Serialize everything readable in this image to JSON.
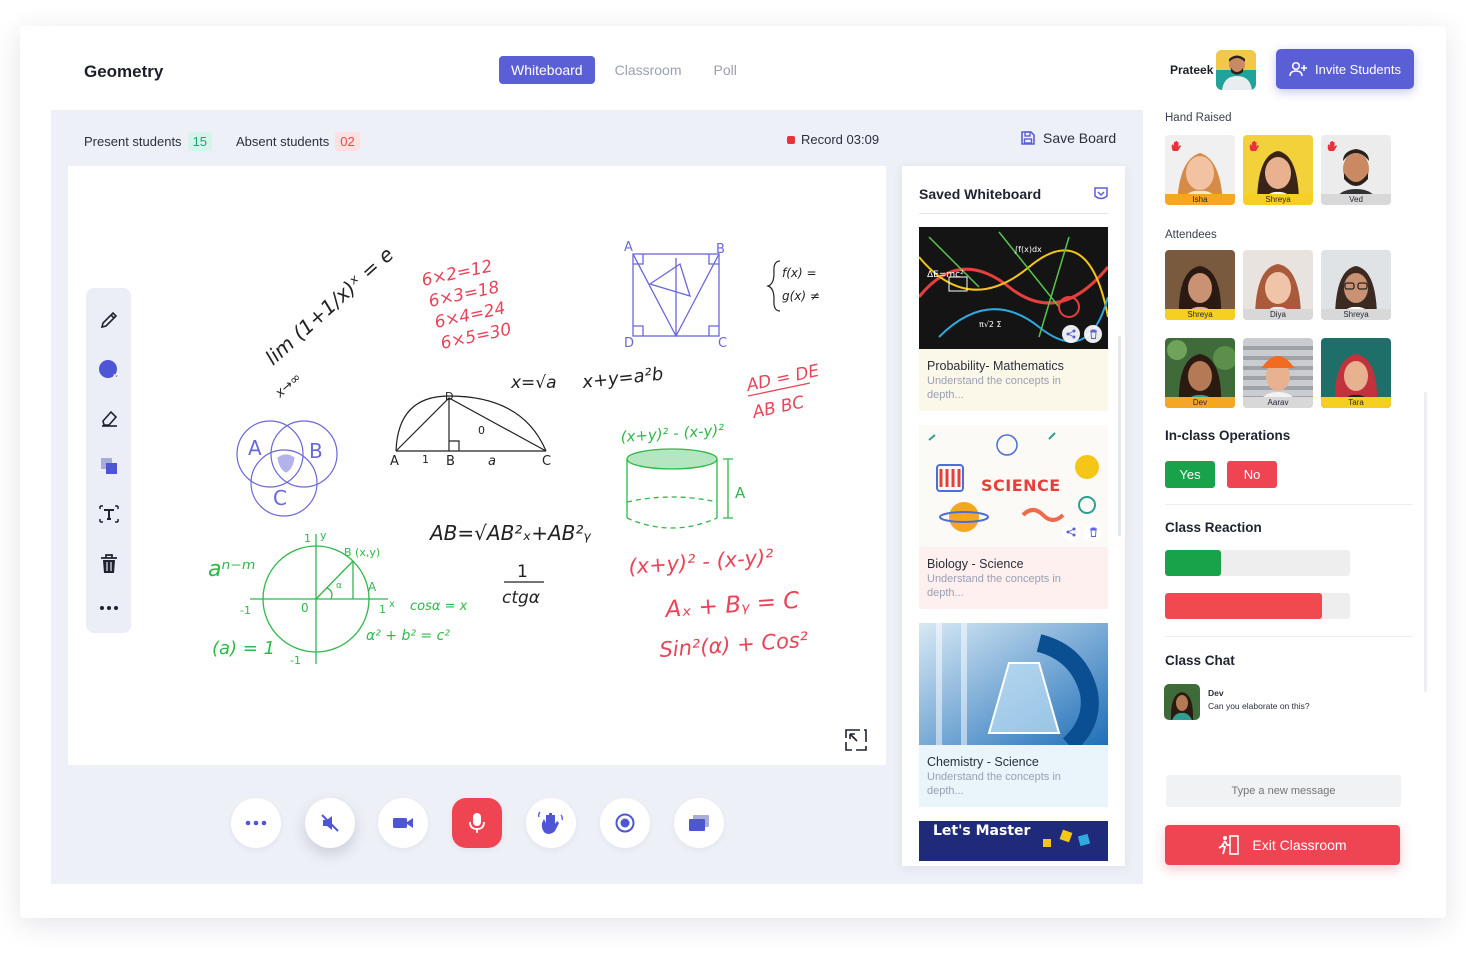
{
  "header": {
    "course_title": "Geometry",
    "tabs": [
      {
        "label": "Whiteboard",
        "active": true
      },
      {
        "label": "Classroom",
        "active": false
      },
      {
        "label": "Poll",
        "active": false
      }
    ],
    "user_name": "Prateek",
    "invite_label": "Invite Students",
    "accent_color": "#5b5fd6"
  },
  "stage": {
    "present_label": "Present students",
    "present_count": "15",
    "absent_label": "Absent students",
    "absent_count": "02",
    "record_label": "Record 03:09",
    "save_label": "Save Board"
  },
  "toolbar": {
    "tools": [
      "pencil-icon",
      "color-picker-icon",
      "eraser-icon",
      "layers-icon",
      "text-tool-icon",
      "trash-icon",
      "more-icon"
    ]
  },
  "whiteboard": {
    "notes": {
      "limit": "lim (1+1/x)ˣ = e",
      "limit_sub": "x→∞",
      "times": [
        "6×2=12",
        "6×3=18",
        "6×4=24",
        "6×5=30"
      ],
      "square_labels": [
        "A",
        "B",
        "D",
        "C"
      ],
      "fx": "f(x) =",
      "gx": "g(x) ≠",
      "sqrt": "x=√a",
      "xy": "x+y=a²b",
      "ratio_top": "AD = DE",
      "ratio_bottom": "AB   BC",
      "arc_labels": [
        "D",
        "A",
        "1",
        "B",
        "a",
        "C",
        "0"
      ],
      "venn": [
        "A",
        "B",
        "C"
      ],
      "poly": "(x+y)² - (x-y)²",
      "cyl_label": "A",
      "ab": "AB=√AB²ₓ+AB²ᵧ",
      "ctg_num": "1",
      "ctg_den": "ctgα",
      "poly2": "(x+y)² - (x-y)²",
      "sum": "Aₓ + Bᵧ = C",
      "trig": "Sin²(α) + Cos²",
      "anm": "aⁿ⁻ᵐ",
      "a1": "(a) = 1",
      "circle_labels": [
        "1",
        "y",
        "B (x,y)",
        "A",
        "-1",
        "0",
        "1",
        "x",
        "-1",
        "α"
      ],
      "cos": "cosα = x",
      "pyth": "α² + b² = c²"
    },
    "colors": {
      "ink": "#222222",
      "red": "#e8445a",
      "blue": "#6a67d8",
      "green": "#2fb84a"
    }
  },
  "controls": [
    "more-icon",
    "speaker-mute-icon",
    "video-icon",
    "mic-icon",
    "hand-wave-icon",
    "record-icon",
    "screen-share-icon"
  ],
  "saved": {
    "title": "Saved Whiteboard",
    "cards": [
      {
        "title": "Probability- Mathematics",
        "desc": "Understand the concepts in depth...",
        "bg": "#fbf8ea"
      },
      {
        "title": "Biology - Science",
        "desc": "Understand the concepts in depth...",
        "bg": "#fdf0ee",
        "img_text": "SCIENCE"
      },
      {
        "title": "Chemistry - Science",
        "desc": "Understand the concepts in depth...",
        "bg": "#e9f4fb"
      },
      {
        "title": "Let's Master",
        "desc": "",
        "bg": "#ffffff"
      }
    ]
  },
  "sidebar": {
    "hand_raised_label": "Hand Raised",
    "hand_raised": [
      {
        "name": "Isha",
        "color": "#f5a623"
      },
      {
        "name": "Shreya",
        "color": "#f5d020"
      },
      {
        "name": "Ved",
        "color": "#d8d8d8"
      }
    ],
    "attendees_label": "Attendees",
    "attendees": [
      {
        "name": "Shreya",
        "color": "#f5d020"
      },
      {
        "name": "Diya",
        "color": "#d8d8d8"
      },
      {
        "name": "Shreya",
        "color": "#d8d8d8"
      },
      {
        "name": "Dev",
        "color": "#f5a623"
      },
      {
        "name": "Aarav",
        "color": "#d8d8d8"
      },
      {
        "name": "Tara",
        "color": "#f5d020"
      }
    ],
    "operations_label": "In-class Operations",
    "yes_label": "Yes",
    "no_label": "No",
    "reaction_label": "Class Reaction",
    "reactions": [
      {
        "level": 0.3,
        "color": "#18a24a"
      },
      {
        "level": 0.85,
        "color": "#f04a50"
      }
    ],
    "chat_label": "Class Chat",
    "chat": [
      {
        "name": "Dev",
        "text": "Can you elaborate on this?"
      }
    ],
    "message_placeholder": "Type a new message",
    "exit_label": "Exit Classroom"
  }
}
